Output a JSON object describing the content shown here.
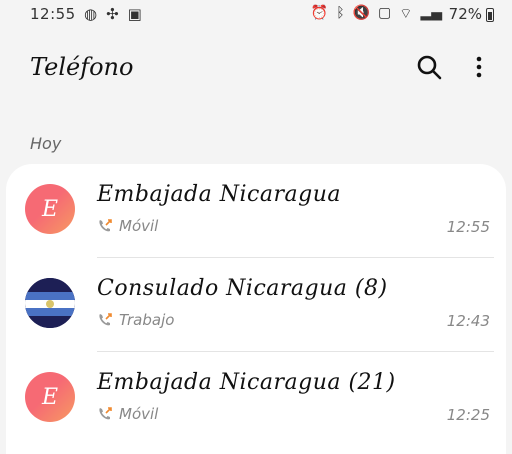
{
  "status_bar": {
    "time": "12:55",
    "left_icons": [
      "whatsapp-icon",
      "pinwheel-icon",
      "gallery-icon"
    ],
    "right_icons": [
      "alarm-icon",
      "bluetooth-icon",
      "mute-icon",
      "nfc-icon",
      "wifi-icon",
      "signal-icon"
    ],
    "battery_percent": "72%"
  },
  "appbar": {
    "title": "Teléfono",
    "search_icon": "search-icon",
    "more_icon": "more-vertical-icon"
  },
  "section_label": "Hoy",
  "calls": [
    {
      "name": "Embajada Nicaragua",
      "type": "Móvil",
      "time": "12:55",
      "avatar_letter": "E",
      "avatar_kind": "letter"
    },
    {
      "name": "Consulado Nicaragua (8)",
      "type": "Trabajo",
      "time": "12:43",
      "avatar_letter": "",
      "avatar_kind": "flag"
    },
    {
      "name": "Embajada Nicaragua (21)",
      "type": "Móvil",
      "time": "12:25",
      "avatar_letter": "E",
      "avatar_kind": "letter"
    }
  ],
  "colors": {
    "avatar_gradient_start": "#f66a74",
    "avatar_gradient_end": "#f79a62",
    "outgoing_arrow": "#f08a30",
    "flag_blue": "#1d4fa0"
  }
}
